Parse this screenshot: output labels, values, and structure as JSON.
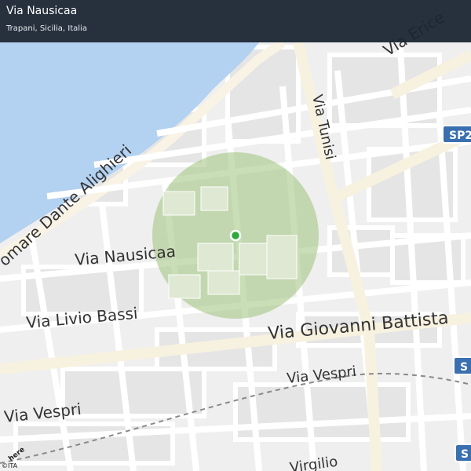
{
  "header": {
    "title": "Via Nausicaa",
    "subtitle": "Trapani, Sicilia, Italia"
  },
  "map": {
    "street_labels": {
      "via_nausicaa": "Via Nausicaa",
      "via_livio_bassi": "Via Livio Bassi",
      "via_giovanni_battista": "Via Giovanni Battista",
      "via_vespri_left": "Via Vespri",
      "via_vespri_right": "Via Vespri",
      "via_tunisi": "Via Tunisi",
      "via_erice": "Via Erice",
      "lungomare": "omare Dante Alighieri",
      "via_virgilio": "Virgilio"
    },
    "road_shields": [
      "SP2",
      "S",
      "S"
    ],
    "colors": {
      "water": "#b3d1f0",
      "land": "#f2f2f2",
      "road": "#ffffff",
      "major_road": "#f8f3e4",
      "block": "#e6e6e6",
      "radius_fill": "#9cc27a",
      "pin": "#2eaa3c"
    }
  },
  "attribution": {
    "logo": "here",
    "copyright": "©ITA"
  }
}
